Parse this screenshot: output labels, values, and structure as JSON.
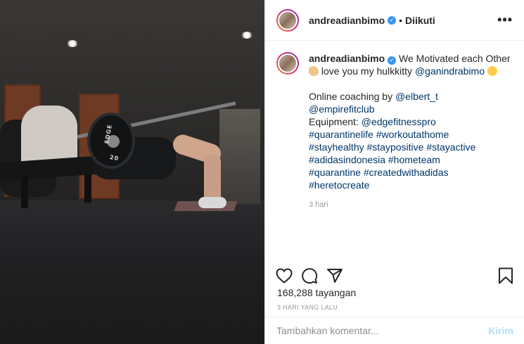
{
  "post": {
    "username": "andreadianbimo",
    "follow_status": "Diikuti",
    "separator": "•",
    "more_label": "•••"
  },
  "caption": {
    "username": "andreadianbimo",
    "text_1": "We Motivated each Other",
    "text_2": "love you my hulkkitty",
    "mention_1": "@ganindrabimo",
    "coach_prefix": "Online coaching by",
    "mention_coach": "@elbert_t",
    "mention_club": "@empirefitclub",
    "equipment_prefix": "Equipment:",
    "mention_equipment": "@edgefitnesspro",
    "hashtags": [
      "#quarantinelife",
      "#workoutathome",
      "#stayhealthy",
      "#staypositive",
      "#stayactive",
      "#adidasindonesia",
      "#hometeam",
      "#quarantine",
      "#createdwithadidas",
      "#heretocreate"
    ],
    "time": "3 hari"
  },
  "media": {
    "plate_text": "EDGE",
    "plate_weight": "20"
  },
  "stats": {
    "views": "168,288 tayangan",
    "posted": "3 HARI YANG LALU"
  },
  "comment": {
    "placeholder": "Tambahkan komentar...",
    "send_label": "Kirim"
  },
  "icons": {
    "like": "heart-icon",
    "comment": "comment-icon",
    "share": "share-icon",
    "save": "bookmark-icon",
    "verified": "verified-badge-icon"
  },
  "colors": {
    "link": "#003569",
    "verified": "#3897f0",
    "send_disabled": "#b2dffc",
    "muted": "#999999"
  }
}
